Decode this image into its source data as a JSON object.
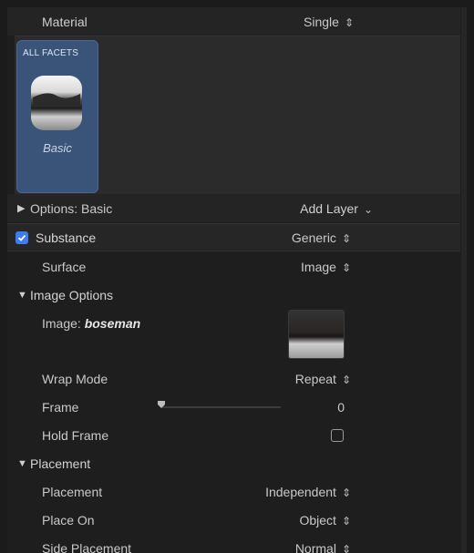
{
  "material": {
    "label": "Material",
    "value": "Single"
  },
  "facets": {
    "tag": "ALL FACETS",
    "name": "Basic"
  },
  "options": {
    "label": "Options: Basic",
    "add_layer": "Add Layer"
  },
  "substance": {
    "label": "Substance",
    "value": "Generic",
    "checked": true
  },
  "surface": {
    "label": "Surface",
    "value": "Image"
  },
  "image_options": {
    "header": "Image Options",
    "image_label": "Image:",
    "image_name": "boseman",
    "wrap_mode_label": "Wrap Mode",
    "wrap_mode_value": "Repeat",
    "frame_label": "Frame",
    "frame_value": "0",
    "hold_frame_label": "Hold Frame"
  },
  "placement": {
    "header": "Placement",
    "placement_label": "Placement",
    "placement_value": "Independent",
    "place_on_label": "Place On",
    "place_on_value": "Object",
    "side_placement_label": "Side Placement",
    "side_placement_value": "Normal"
  },
  "icons": {
    "updown": "up-down-chevron-icon",
    "disclosure_right": "disclosure-triangle-right-icon",
    "disclosure_down": "disclosure-triangle-down-icon",
    "chevron_down": "chevron-down-icon"
  },
  "colors": {
    "accent": "#3f7bf2",
    "facet_tile": "#3a5479"
  }
}
